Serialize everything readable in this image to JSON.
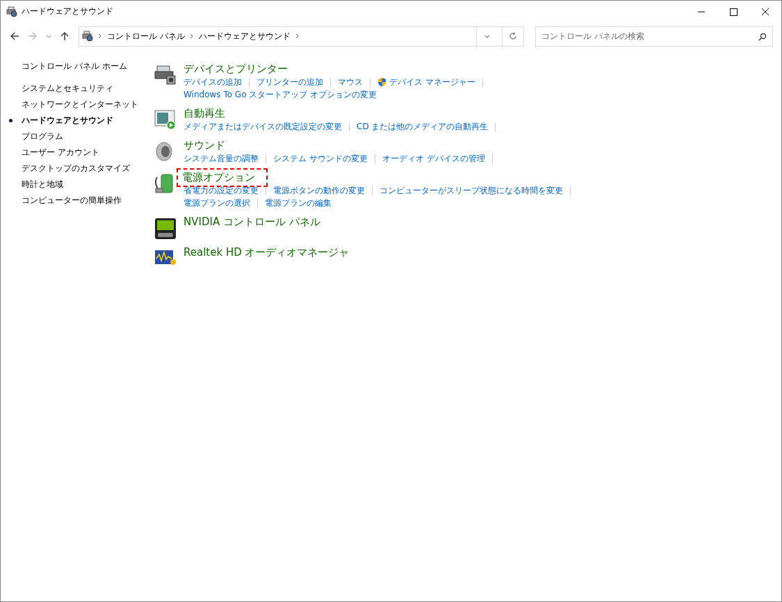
{
  "window": {
    "title": "ハードウェアとサウンド"
  },
  "address_bar": {
    "breadcrumbs": [
      "コントロール パネル",
      "ハードウェアとサウンド"
    ]
  },
  "search": {
    "placeholder": "コントロール パネルの検索"
  },
  "sidebar": {
    "home": "コントロール パネル ホーム",
    "items": [
      {
        "label": "システムとセキュリティ",
        "selected": false
      },
      {
        "label": "ネットワークとインターネット",
        "selected": false
      },
      {
        "label": "ハードウェアとサウンド",
        "selected": true
      },
      {
        "label": "プログラム",
        "selected": false
      },
      {
        "label": "ユーザー アカウント",
        "selected": false
      },
      {
        "label": "デスクトップのカスタマイズ",
        "selected": false
      },
      {
        "label": "時計と地域",
        "selected": false
      },
      {
        "label": "コンピューターの簡単操作",
        "selected": false
      }
    ]
  },
  "categories": [
    {
      "kind": "printer",
      "title": "デバイスとプリンター",
      "highlighted": false,
      "link_rows": [
        [
          {
            "label": "デバイスの追加",
            "shield": false
          },
          {
            "label": "プリンターの追加",
            "shield": false
          },
          {
            "label": "マウス",
            "shield": false
          },
          {
            "label": "デバイス マネージャー",
            "shield": true
          }
        ],
        [
          {
            "label": "Windows To Go スタートアップ オプションの変更",
            "shield": false
          }
        ]
      ]
    },
    {
      "kind": "autoplay",
      "title": "自動再生",
      "highlighted": false,
      "link_rows": [
        [
          {
            "label": "メディアまたはデバイスの既定設定の変更",
            "shield": false
          },
          {
            "label": "CD または他のメディアの自動再生",
            "shield": false
          }
        ]
      ]
    },
    {
      "kind": "speaker",
      "title": "サウンド",
      "highlighted": false,
      "link_rows": [
        [
          {
            "label": "システム音量の調整",
            "shield": false
          },
          {
            "label": "システム サウンドの変更",
            "shield": false
          },
          {
            "label": "オーディオ デバイスの管理",
            "shield": false
          }
        ]
      ]
    },
    {
      "kind": "battery",
      "title": "電源オプション",
      "highlighted": true,
      "link_rows": [
        [
          {
            "label": "省電力の設定の変更",
            "shield": false
          },
          {
            "label": "電源ボタンの動作の変更",
            "shield": false
          },
          {
            "label": "コンピューターがスリープ状態になる時間を変更",
            "shield": false
          }
        ],
        [
          {
            "label": "電源プランの選択",
            "shield": false
          },
          {
            "label": "電源プランの編集",
            "shield": false
          }
        ]
      ]
    },
    {
      "kind": "nvidia",
      "title": "NVIDIA コントロール パネル",
      "highlighted": false
    },
    {
      "kind": "audio-manager",
      "title": "Realtek HD オーディオマネージャ",
      "highlighted": false
    }
  ]
}
